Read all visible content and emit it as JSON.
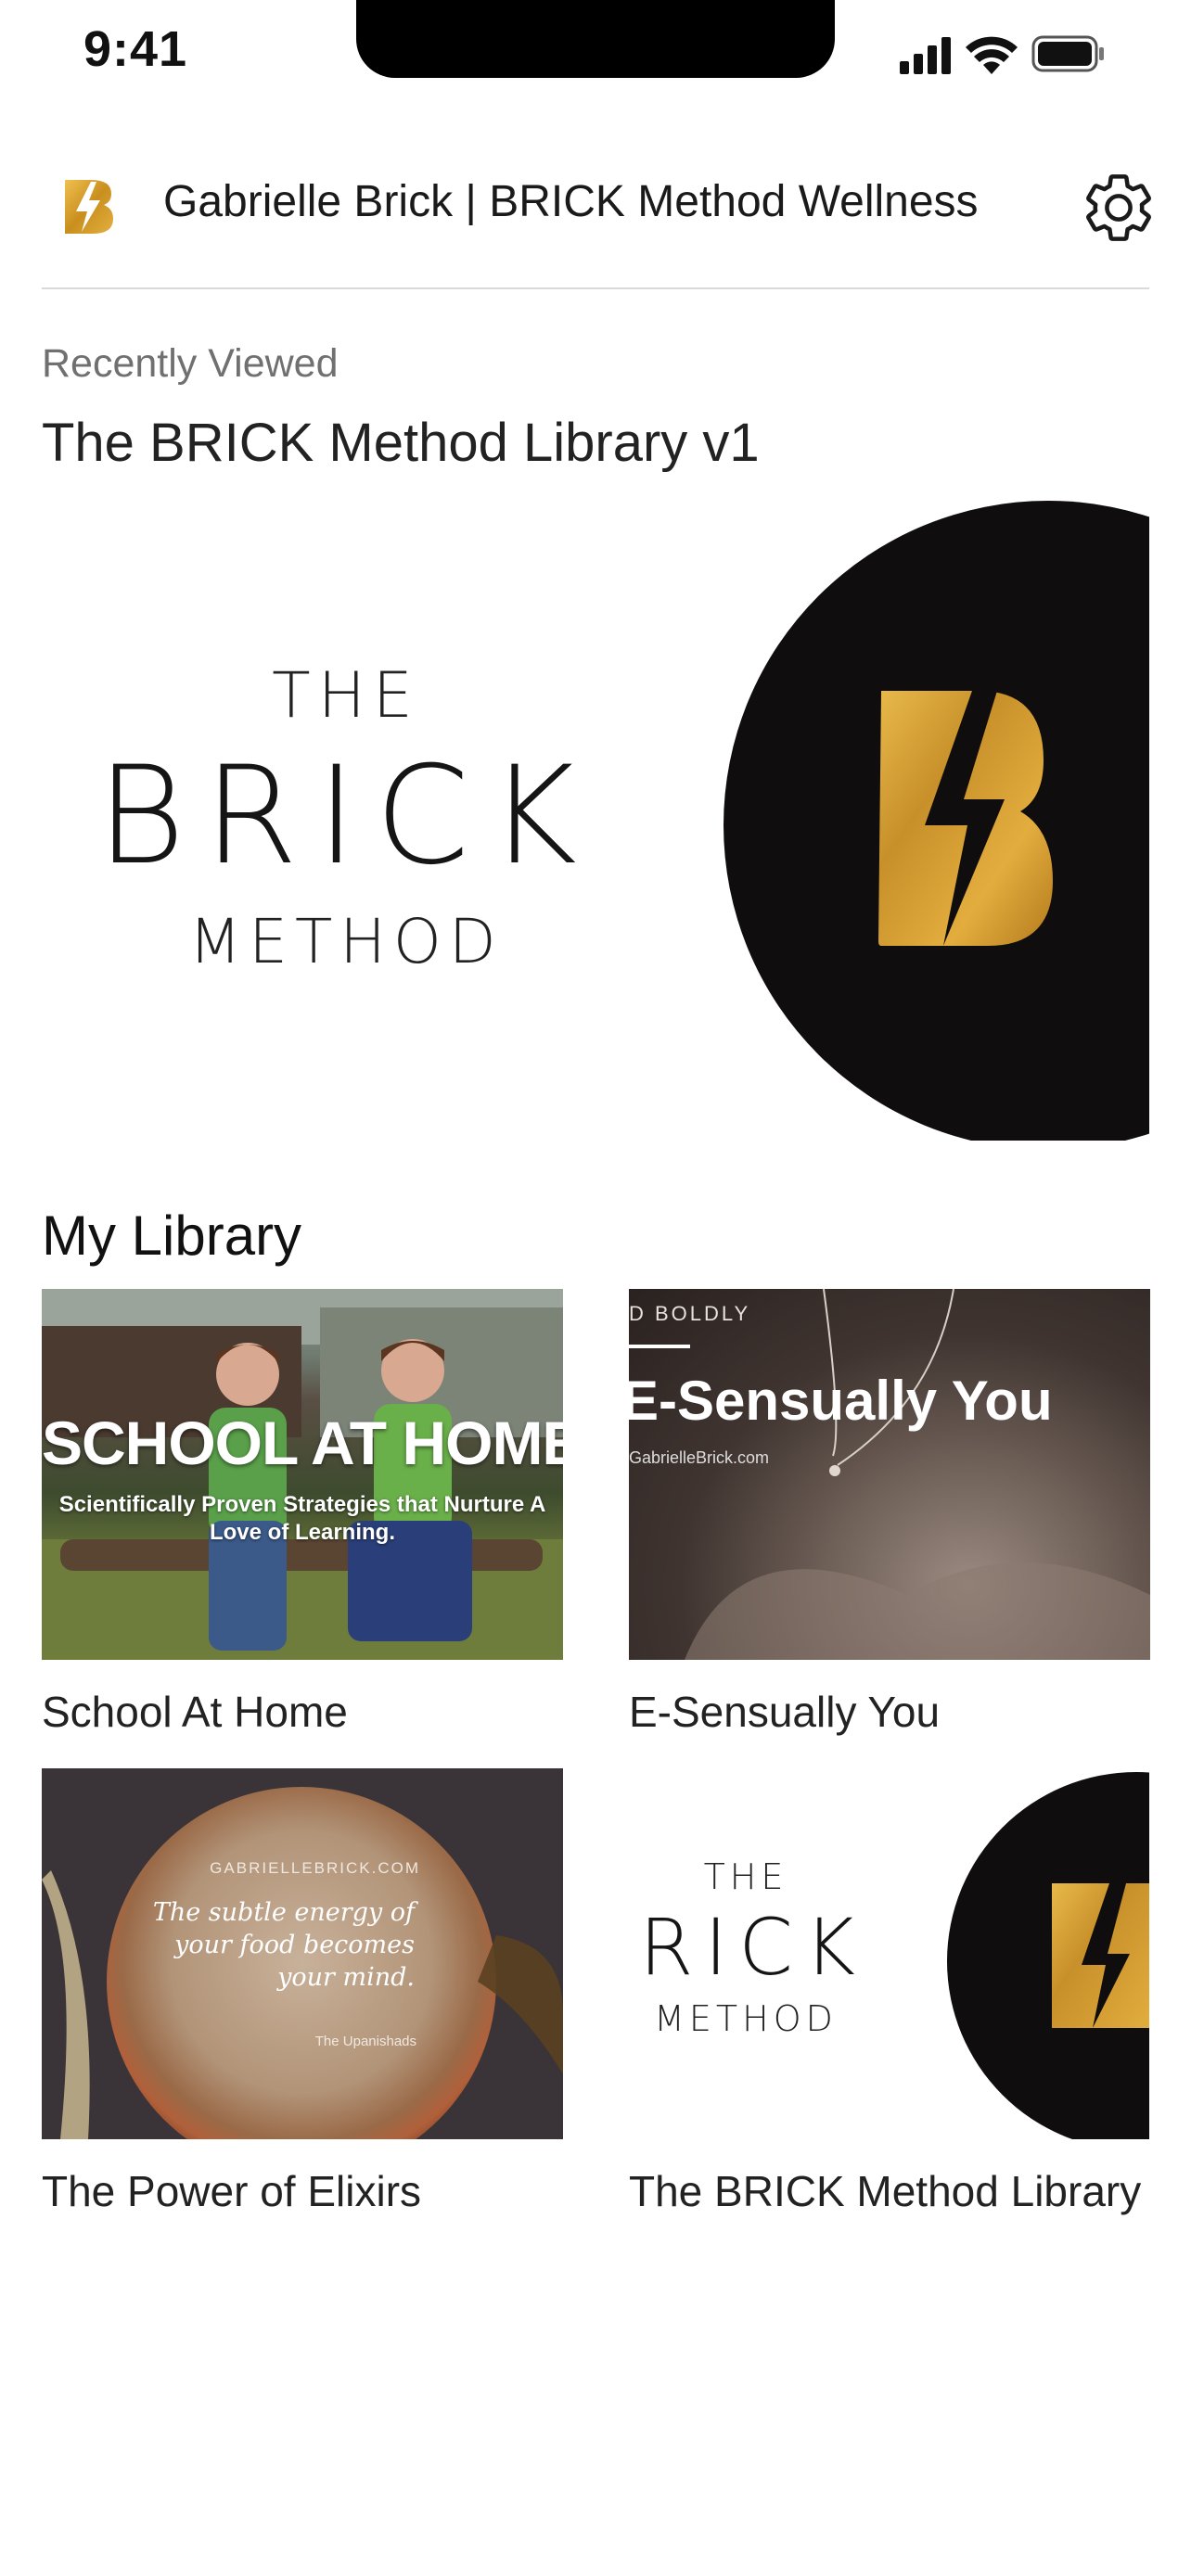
{
  "status_bar": {
    "time": "9:41"
  },
  "header": {
    "title": "Gabrielle Brick | BRICK Method Wellness"
  },
  "recently_viewed": {
    "label": "Recently Viewed",
    "title": "The BRICK Method Library v1",
    "artwork": {
      "line1": "THE",
      "line2": "BRICK",
      "line3": "METHOD"
    }
  },
  "library": {
    "heading": "My Library",
    "items": [
      {
        "title": "School At Home",
        "thumb": {
          "headline": "SCHOOL AT HOME",
          "subtitle_1": "Scientifically Proven Strategies that Nurture A",
          "subtitle_2": "Love of Learning."
        }
      },
      {
        "title": "E-Sensually You",
        "thumb": {
          "kicker": "D BOLDLY",
          "headline": "E-Sensually You",
          "site": "GabrielleBrick.com"
        }
      },
      {
        "title": "The Power of Elixirs",
        "thumb": {
          "site": "GABRIELLEBRICK.COM",
          "quote_1": "The subtle energy of",
          "quote_2": "your food becomes",
          "quote_3": "your mind.",
          "author": "The Upanishads"
        }
      },
      {
        "title": "The BRICK Method Library",
        "thumb": {
          "line1": "THE",
          "line2": "BRICK",
          "line3": "METHOD"
        }
      }
    ]
  },
  "colors": {
    "gold": "#d4a02e",
    "dark": "#0f0d0d",
    "divider": "#d9d9d9",
    "muted_text": "#707070"
  }
}
